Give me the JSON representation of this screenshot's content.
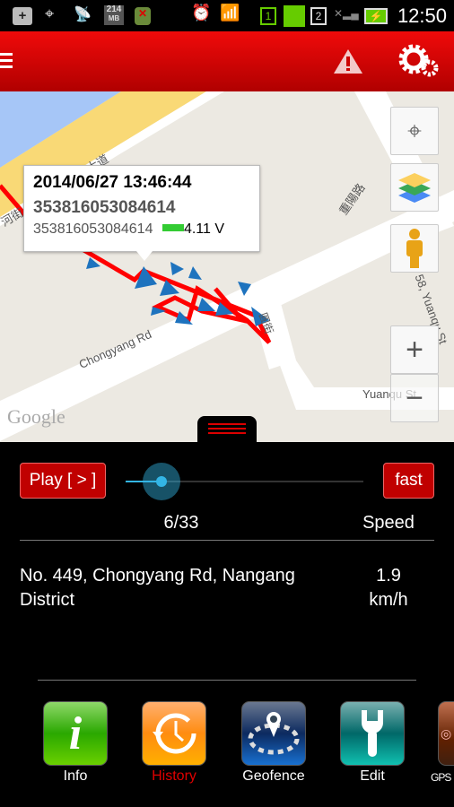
{
  "status_bar": {
    "memory": "214",
    "memory_unit": "MB",
    "sim": "1",
    "sim2": "2",
    "time": "12:50"
  },
  "header": {
    "menu_icon": "hamburger-icon",
    "alert_icon": "warning-icon",
    "settings_icon": "gear-icon"
  },
  "map": {
    "labels": {
      "road1": "Chongyang Rd",
      "road2": "重陽路",
      "road3": "Yuanqu St",
      "road4": "Lane 58, Yuanqu St",
      "road5": "河街",
      "road6": "大道",
      "road7": "圓街",
      "logo": "Google"
    },
    "popup": {
      "datetime": "2014/06/27 13:46:44",
      "device_id_bold": "353816053084614",
      "device_id": "353816053084614",
      "voltage": "4.11 V"
    },
    "route_color": "#ff0000",
    "marker_color": "#1e73be"
  },
  "playback": {
    "play_label": "Play [ > ]",
    "speed_button": "fast",
    "position": "6/33",
    "progress": 0.15,
    "speed_header": "Speed",
    "address": "No. 449, Chongyang Rd, Nangang District",
    "speed_value": "1.9",
    "speed_unit": "km/h"
  },
  "nav": [
    {
      "label": "Info",
      "active": false
    },
    {
      "label": "History",
      "active": true
    },
    {
      "label": "Geofence",
      "active": false
    },
    {
      "label": "Edit",
      "active": false
    },
    {
      "label": "GPS",
      "active": false
    }
  ],
  "colors": {
    "header": "#e00000",
    "active_nav": "#e00000"
  }
}
